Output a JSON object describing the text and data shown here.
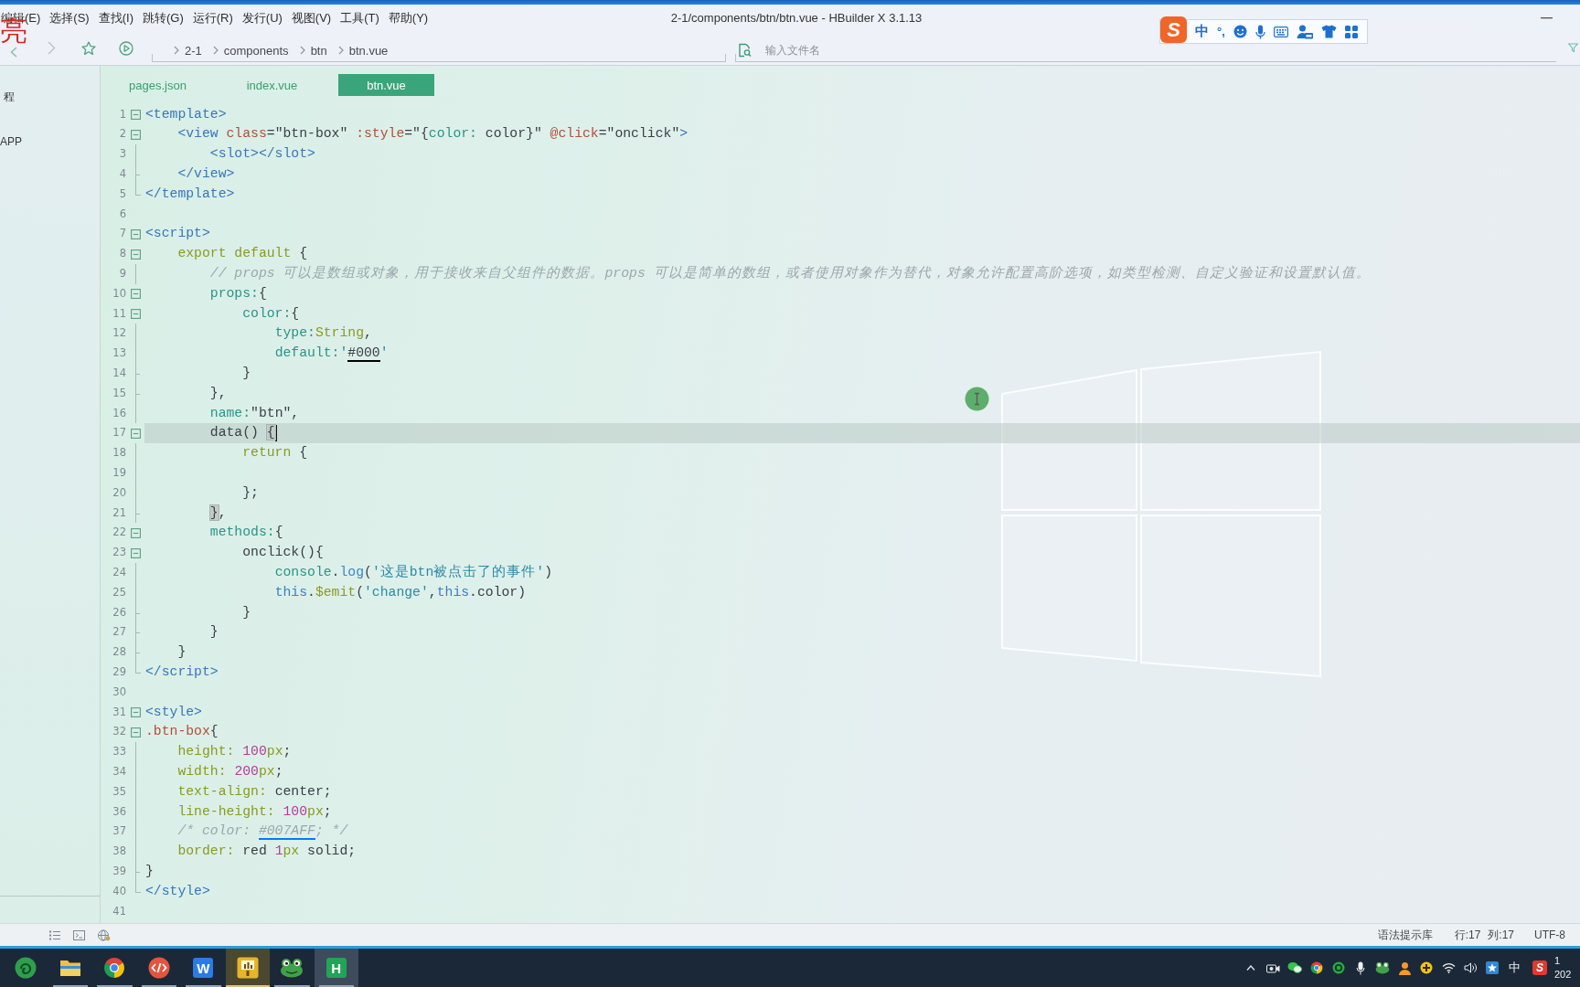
{
  "window": {
    "title": "2-1/components/btn/btn.vue - HBuilder X 3.1.13"
  },
  "menu": [
    "编辑(E)",
    "选择(S)",
    "查找(I)",
    "跳转(G)",
    "运行(R)",
    "发行(U)",
    "视图(V)",
    "工具(T)",
    "帮助(Y)"
  ],
  "overlay_text": "亮",
  "ime_toolbar": {
    "logo": "S",
    "mode": "中",
    "punctuation": "°,"
  },
  "toolbar": {
    "breadcrumb": [
      "2-1",
      "components",
      "btn",
      "btn.vue"
    ],
    "file_search": {
      "placeholder": "输入文件名"
    }
  },
  "sidebar": {
    "items": [
      "程",
      "APP"
    ]
  },
  "tabs": [
    {
      "label": "pages.json",
      "selected": false
    },
    {
      "label": "index.vue",
      "selected": false
    },
    {
      "label": "btn.vue",
      "selected": true
    }
  ],
  "editor": {
    "lines": [
      {
        "number": "1",
        "kind": "open",
        "current": false,
        "tokens": [
          {
            "text": "<template>",
            "kind": "tag"
          }
        ]
      },
      {
        "number": "2",
        "kind": "open",
        "current": false,
        "tokens": [
          {
            "text": "    <view ",
            "kind": "tag"
          },
          {
            "text": "class",
            "kind": "attr"
          },
          {
            "text": "=\"btn-box\" ",
            "kind": "plain"
          },
          {
            "text": ":style",
            "kind": "attr"
          },
          {
            "text": "=\"{",
            "kind": "plain"
          },
          {
            "text": "color:",
            "kind": "prop"
          },
          {
            "text": " color}\" ",
            "kind": "plain"
          },
          {
            "text": "@click",
            "kind": "attr"
          },
          {
            "text": "=\"onclick\"",
            "kind": "plain"
          },
          {
            "text": ">",
            "kind": "tag"
          }
        ]
      },
      {
        "number": "3",
        "kind": "inner",
        "current": false,
        "tokens": [
          {
            "text": "        <slot></slot>",
            "kind": "tag"
          }
        ]
      },
      {
        "number": "4",
        "kind": "close",
        "current": false,
        "tokens": [
          {
            "text": "    </view>",
            "kind": "tag"
          }
        ]
      },
      {
        "number": "5",
        "kind": "last",
        "current": false,
        "tokens": [
          {
            "text": "</template>",
            "kind": "tag"
          }
        ]
      },
      {
        "number": "6",
        "kind": "blank",
        "current": false
      },
      {
        "number": "7",
        "kind": "open",
        "current": false,
        "tokens": [
          {
            "text": "<script>",
            "kind": "tag"
          }
        ]
      },
      {
        "number": "8",
        "kind": "open",
        "current": false,
        "tokens": [
          {
            "text": "    export default",
            "kind": "keyword"
          },
          {
            "text": " {",
            "kind": "plain"
          }
        ]
      },
      {
        "number": "9",
        "kind": "inner",
        "current": false,
        "tokens": [
          {
            "text": "        // props 可以是数组或对象，用于接收来自父组件的数据。props 可以是简单的数组，或者使用对象作为替代，对象允许配置高阶选项，如类型检测、自定义验证和设置默认值。",
            "kind": "comment"
          }
        ]
      },
      {
        "number": "10",
        "kind": "open",
        "current": false,
        "tokens": [
          {
            "text": "        props:",
            "kind": "prop"
          },
          {
            "text": "{",
            "kind": "plain"
          }
        ]
      },
      {
        "number": "11",
        "kind": "open",
        "current": false,
        "tokens": [
          {
            "text": "            color:",
            "kind": "prop"
          },
          {
            "text": "{",
            "kind": "plain"
          }
        ]
      },
      {
        "number": "12",
        "kind": "inner",
        "current": false,
        "tokens": [
          {
            "text": "                type:",
            "kind": "prop"
          },
          {
            "text": "String",
            "kind": "keyword"
          },
          {
            "text": ",",
            "kind": "plain"
          }
        ]
      },
      {
        "number": "13",
        "kind": "inner",
        "current": false,
        "tokens": [
          {
            "text": "                default:",
            "kind": "prop"
          },
          {
            "text": "'",
            "kind": "string"
          },
          {
            "text": "#000",
            "kind": "plain",
            "color": "#000000"
          },
          {
            "text": "'",
            "kind": "string"
          }
        ]
      },
      {
        "number": "14",
        "kind": "close",
        "current": false,
        "tokens": [
          {
            "text": "            }",
            "kind": "plain"
          }
        ]
      },
      {
        "number": "15",
        "kind": "close",
        "current": false,
        "tokens": [
          {
            "text": "        },",
            "kind": "plain"
          }
        ]
      },
      {
        "number": "16",
        "kind": "inner",
        "current": false,
        "tokens": [
          {
            "text": "        name:",
            "kind": "prop"
          },
          {
            "text": "\"btn\",",
            "kind": "plain"
          }
        ]
      },
      {
        "number": "17",
        "kind": "open",
        "current": true,
        "tokens": [
          {
            "text": "        data() ",
            "kind": "plain"
          },
          {
            "text": "{",
            "kind": "bracket"
          }
        ]
      },
      {
        "number": "18",
        "kind": "inner",
        "current": false,
        "tokens": [
          {
            "text": "            return",
            "kind": "keyword"
          },
          {
            "text": " {",
            "kind": "plain"
          }
        ]
      },
      {
        "number": "19",
        "kind": "inner",
        "current": false
      },
      {
        "number": "20",
        "kind": "inner",
        "current": false,
        "tokens": [
          {
            "text": "            };",
            "kind": "plain"
          }
        ]
      },
      {
        "number": "21",
        "kind": "close",
        "current": false,
        "tokens": [
          {
            "text": "        }",
            "kind": "bracket"
          },
          {
            "text": ",",
            "kind": "plain"
          }
        ]
      },
      {
        "number": "22",
        "kind": "open",
        "current": false,
        "tokens": [
          {
            "text": "        methods:",
            "kind": "prop"
          },
          {
            "text": "{",
            "kind": "plain"
          }
        ]
      },
      {
        "number": "23",
        "kind": "open",
        "current": false,
        "tokens": [
          {
            "text": "            onclick(){",
            "kind": "plain"
          }
        ]
      },
      {
        "number": "24",
        "kind": "inner",
        "current": false,
        "tokens": [
          {
            "text": "                console",
            "kind": "prop"
          },
          {
            "text": ".",
            "kind": "plain"
          },
          {
            "text": "log",
            "kind": "method"
          },
          {
            "text": "(",
            "kind": "plain"
          },
          {
            "text": "'这是btn被点击了的事件'",
            "kind": "string"
          },
          {
            "text": ")",
            "kind": "plain"
          }
        ]
      },
      {
        "number": "25",
        "kind": "inner",
        "current": false,
        "tokens": [
          {
            "text": "                this",
            "kind": "this"
          },
          {
            "text": ".",
            "kind": "plain"
          },
          {
            "text": "$emit",
            "kind": "keyword"
          },
          {
            "text": "(",
            "kind": "plain"
          },
          {
            "text": "'change'",
            "kind": "string"
          },
          {
            "text": ",",
            "kind": "plain"
          },
          {
            "text": "this",
            "kind": "this"
          },
          {
            "text": ".color)",
            "kind": "plain"
          }
        ]
      },
      {
        "number": "26",
        "kind": "close",
        "current": false,
        "tokens": [
          {
            "text": "            }",
            "kind": "plain"
          }
        ]
      },
      {
        "number": "27",
        "kind": "close",
        "current": false,
        "tokens": [
          {
            "text": "        }",
            "kind": "plain"
          }
        ]
      },
      {
        "number": "28",
        "kind": "close",
        "current": false,
        "tokens": [
          {
            "text": "    }",
            "kind": "plain"
          }
        ]
      },
      {
        "number": "29",
        "kind": "last",
        "current": false,
        "tokens": [
          {
            "text": "</script>",
            "kind": "tag"
          }
        ]
      },
      {
        "number": "30",
        "kind": "blank",
        "current": false
      },
      {
        "number": "31",
        "kind": "open",
        "current": false,
        "tokens": [
          {
            "text": "<style>",
            "kind": "tag"
          }
        ]
      },
      {
        "number": "32",
        "kind": "open",
        "current": false,
        "tokens": [
          {
            "text": ".btn-box",
            "kind": "attr"
          },
          {
            "text": "{",
            "kind": "plain"
          }
        ]
      },
      {
        "number": "33",
        "kind": "inner",
        "current": false,
        "tokens": [
          {
            "text": "    height: ",
            "kind": "keyword"
          },
          {
            "text": "100",
            "kind": "number"
          },
          {
            "text": "px",
            "kind": "keyword"
          },
          {
            "text": ";",
            "kind": "plain"
          }
        ]
      },
      {
        "number": "34",
        "kind": "inner",
        "current": false,
        "tokens": [
          {
            "text": "    width: ",
            "kind": "keyword"
          },
          {
            "text": "200",
            "kind": "number"
          },
          {
            "text": "px",
            "kind": "keyword"
          },
          {
            "text": ";",
            "kind": "plain"
          }
        ]
      },
      {
        "number": "35",
        "kind": "inner",
        "current": false,
        "tokens": [
          {
            "text": "    text-align:",
            "kind": "keyword"
          },
          {
            "text": " center;",
            "kind": "plain"
          }
        ]
      },
      {
        "number": "36",
        "kind": "inner",
        "current": false,
        "tokens": [
          {
            "text": "    line-height: ",
            "kind": "keyword"
          },
          {
            "text": "100",
            "kind": "number"
          },
          {
            "text": "px",
            "kind": "keyword"
          },
          {
            "text": ";",
            "kind": "plain"
          }
        ]
      },
      {
        "number": "37",
        "kind": "inner",
        "current": false,
        "tokens": [
          {
            "text": "    /* color: ",
            "kind": "comment"
          },
          {
            "text": "#007AFF",
            "kind": "comment",
            "color": "#007aff"
          },
          {
            "text": "; */",
            "kind": "comment"
          }
        ]
      },
      {
        "number": "38",
        "kind": "inner",
        "current": false,
        "tokens": [
          {
            "text": "    border:",
            "kind": "keyword"
          },
          {
            "text": " red ",
            "kind": "plain"
          },
          {
            "text": "1",
            "kind": "number"
          },
          {
            "text": "px",
            "kind": "keyword"
          },
          {
            "text": " solid;",
            "kind": "plain"
          }
        ]
      },
      {
        "number": "39",
        "kind": "close",
        "current": false,
        "tokens": [
          {
            "text": "}",
            "kind": "plain"
          }
        ]
      },
      {
        "number": "40",
        "kind": "last",
        "current": false,
        "tokens": [
          {
            "text": "</style>",
            "kind": "tag"
          }
        ]
      },
      {
        "number": "41",
        "kind": "blank",
        "current": false
      }
    ]
  },
  "status_bar": {
    "items": [
      "语法提示库",
      "行:17",
      "列:17",
      "UTF-8"
    ]
  },
  "taskbar": {
    "apps": [
      {
        "kind": "swirl",
        "running": false,
        "alert": false,
        "selected": false
      },
      {
        "kind": "folder",
        "running": true,
        "alert": false,
        "selected": false
      },
      {
        "kind": "browser",
        "running": true,
        "alert": false,
        "selected": false
      },
      {
        "kind": "code",
        "running": true,
        "alert": false,
        "selected": false
      },
      {
        "kind": "tile",
        "glyph": "W",
        "color": "#2b7be6",
        "running": true,
        "alert": false,
        "selected": false
      },
      {
        "kind": "slides",
        "running": true,
        "alert": true,
        "selected": false
      },
      {
        "kind": "frog",
        "running": true,
        "alert": false,
        "selected": false
      },
      {
        "kind": "tile",
        "glyph": "H",
        "color": "#21a456",
        "running": true,
        "alert": false,
        "selected": true
      }
    ],
    "tray": {
      "input_mode": "中",
      "logo": "S"
    },
    "clock": {
      "time": "1",
      "date": "202"
    }
  }
}
